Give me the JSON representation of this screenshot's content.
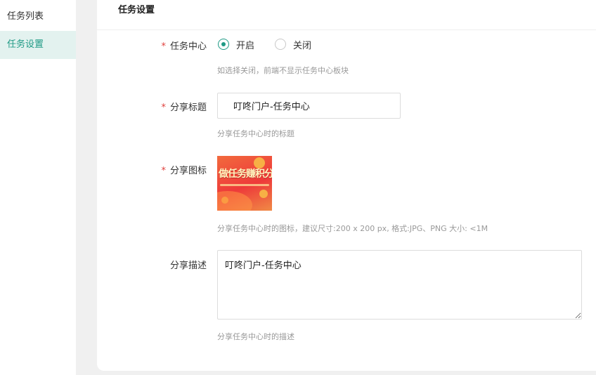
{
  "sidebar": {
    "items": [
      {
        "label": "任务列表",
        "active": false
      },
      {
        "label": "任务设置",
        "active": true
      }
    ]
  },
  "panel": {
    "title": "任务设置"
  },
  "form": {
    "required_mark": "*",
    "task_center": {
      "label": "任务中心",
      "options": [
        {
          "label": "开启",
          "checked": true
        },
        {
          "label": "关闭",
          "checked": false
        }
      ],
      "tip": "如选择关闭，前端不显示任务中心板块"
    },
    "share_title": {
      "label": "分享标题",
      "value": "叮咚门户-任务中心",
      "tip": "分享任务中心时的标题"
    },
    "share_icon": {
      "label": "分享图标",
      "image_text": "做任务赚积分",
      "tip": "分享任务中心时的图标，建议尺寸:200 x 200 px, 格式:JPG、PNG 大小: <1M"
    },
    "share_desc": {
      "label": "分享描述",
      "value": "叮咚门户-任务中心",
      "tip": "分享任务中心时的描述"
    }
  },
  "colors": {
    "accent": "#1f9a85",
    "required": "#e0413e",
    "active_bg": "#e3f2ef"
  }
}
